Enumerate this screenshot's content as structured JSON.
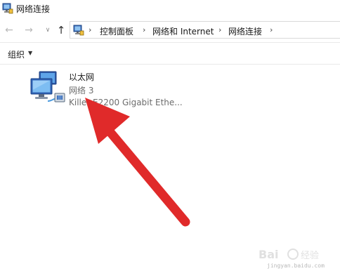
{
  "window": {
    "title": "网络连接",
    "icon": "network-connections-icon"
  },
  "navigation": {
    "back_icon": "arrow-left-icon",
    "forward_icon": "arrow-right-icon",
    "recent_icon": "chevron-down-icon",
    "up_icon": "arrow-up-icon",
    "breadcrumbs": [
      "控制面板",
      "网络和 Internet",
      "网络连接"
    ],
    "separator": "›"
  },
  "toolbar": {
    "organize_label": "组织",
    "organize_caret": "▼"
  },
  "connections": [
    {
      "name": "以太网",
      "status": "网络 3",
      "adapter": "Killer E2200 Gigabit Ethe..."
    }
  ],
  "overlay": {
    "arrow_color": "#e02a2a"
  },
  "watermark": {
    "text": "jingyan.baidu.com"
  }
}
